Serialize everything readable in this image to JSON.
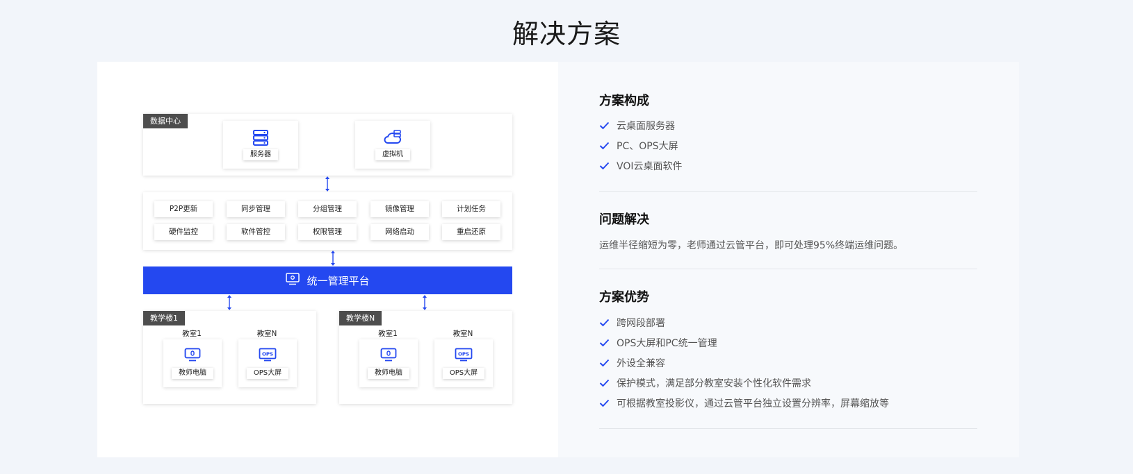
{
  "page_title": "解决方案",
  "diagram": {
    "datacenter": {
      "tag": "数据中心",
      "server_label": "服务器",
      "vm_label": "虚拟机"
    },
    "functions": [
      [
        "P2P更新",
        "同步管理",
        "分组管理",
        "镜像管理",
        "计划任务"
      ],
      [
        "硬件监控",
        "软件管控",
        "权限管理",
        "网络启动",
        "重启还原"
      ]
    ],
    "platform_label": "统一管理平台",
    "building1": {
      "tag": "教学楼1",
      "room1": "教室1",
      "roomN": "教室N",
      "pc_label": "教师电脑",
      "ops_label": "OPS大屏"
    },
    "buildingN": {
      "tag": "教学楼N",
      "room1": "教室1",
      "roomN": "教室N",
      "pc_label": "教师电脑",
      "ops_label": "OPS大屏"
    },
    "ops_icon_text": "OPS",
    "accent_color": "#2448f0"
  },
  "composition": {
    "title": "方案构成",
    "items": [
      "云桌面服务器",
      "PC、OPS大屏",
      "VOI云桌面软件"
    ]
  },
  "problem": {
    "title": "问题解决",
    "text": "运维半径缩短为零，老师通过云管平台，即可处理95%终端运维问题。"
  },
  "advantages": {
    "title": "方案优势",
    "items": [
      "跨网段部署",
      "OPS大屏和PC统一管理",
      "外设全兼容",
      "保护模式，满足部分教室安装个性化软件需求",
      "可根据教室投影仪，通过云管平台独立设置分辨率，屏幕缩放等"
    ]
  }
}
